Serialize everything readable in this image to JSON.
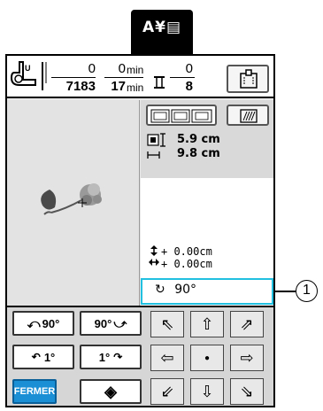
{
  "top_tab": {
    "label": "A¥▤"
  },
  "header": {
    "stitch_top": "0",
    "stitch_bottom": "7183",
    "time_top": "0",
    "time_top_unit": "min",
    "time_bottom": "17",
    "time_bottom_unit": "min",
    "color_top": "0",
    "color_bottom": "8"
  },
  "size": {
    "height": "5.9 cm",
    "width": "9.8 cm"
  },
  "offset": {
    "vertical": "+ 0.00cm",
    "horizontal": "+ 0.00cm"
  },
  "rotation": {
    "value": "90°"
  },
  "callout": {
    "number": "1"
  },
  "buttons": {
    "rotate_left_90": "90°",
    "rotate_right_90": "90°",
    "rotate_left_1": "1°",
    "rotate_right_1": "1°",
    "close": "FERMER"
  },
  "colors": {
    "highlight": "#21c0e0",
    "close_button": "#1a8fd6"
  }
}
